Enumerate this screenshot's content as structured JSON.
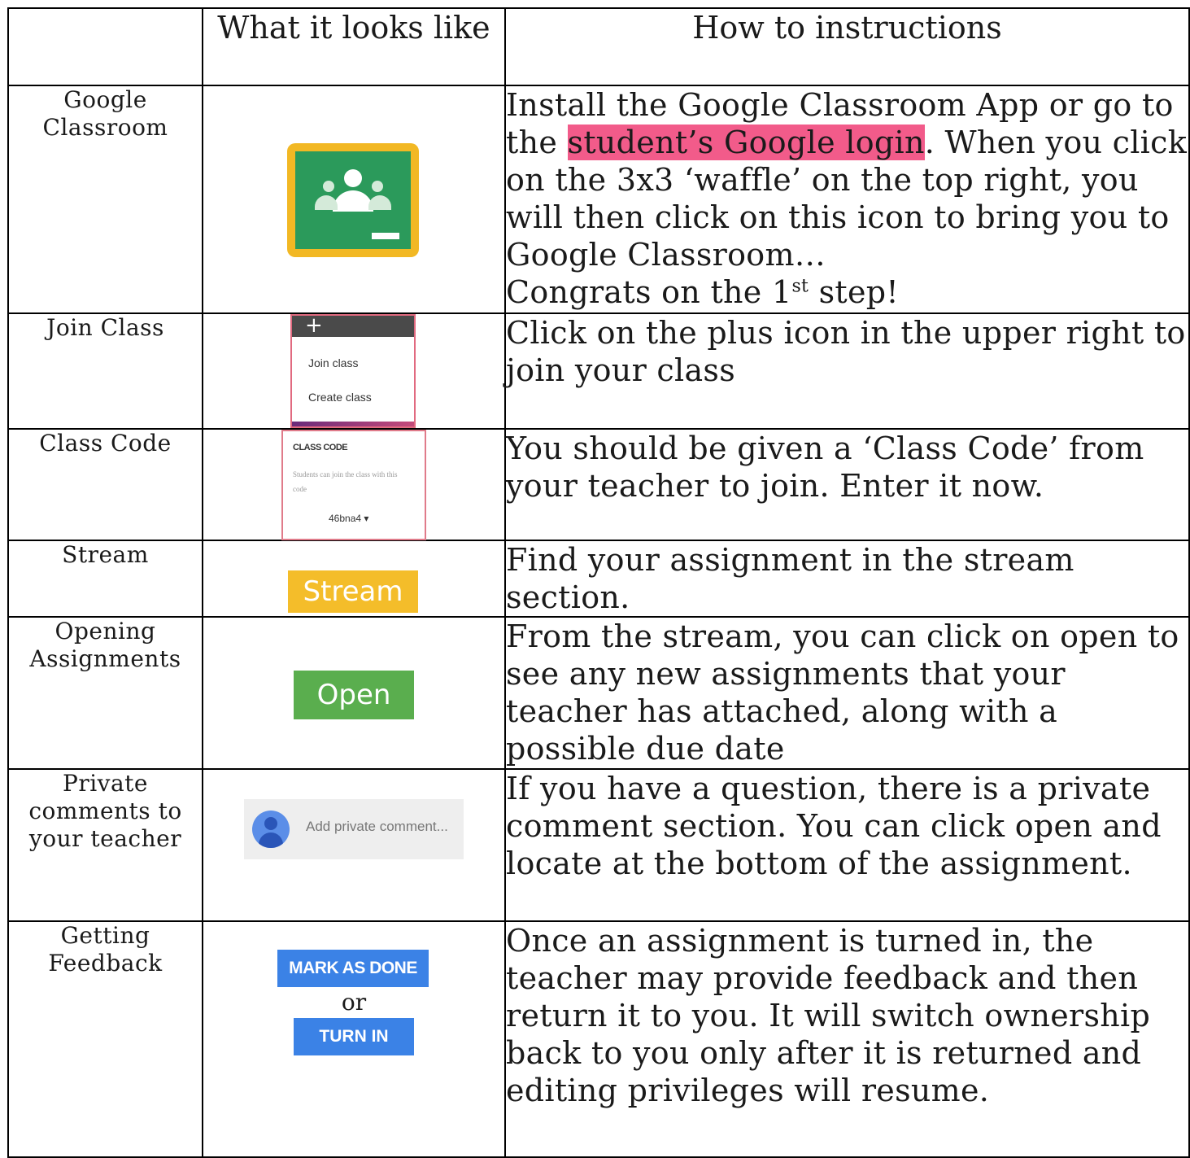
{
  "header": {
    "col1": "",
    "col2": "What it looks like",
    "col3": "How to instructions"
  },
  "rows": [
    {
      "label": "Google Classroom",
      "icon": "google-classroom-icon",
      "instr_before": "Install the Google Classroom App or go to the ",
      "instr_highlight": "student’s Google login",
      "instr_after": ". When you click on the 3x3 ‘waffle’ on the top right, you will then click on this icon to bring you to Google Classroom…",
      "instr_congrats": "Congrats on the 1",
      "instr_sup": "st",
      "instr_end": " step!",
      "highlight_color": "#f25b8a"
    },
    {
      "label": "Join Class",
      "menu_plus": "+",
      "menu_items": [
        "Join class",
        "Create class"
      ],
      "instr": "Click on the plus icon in the upper right to join your class"
    },
    {
      "label": "Class Code",
      "code_title": "CLASS CODE",
      "code_desc": "Students can join the class with this code",
      "code_value": "46bna4 ▾",
      "instr": "You should be given a ‘Class Code’ from your teacher to join. Enter it now."
    },
    {
      "label": "Stream",
      "button": "Stream",
      "button_color": "#f4bd2a",
      "instr": "Find your assignment in the stream section."
    },
    {
      "label": "Opening Assignments",
      "button": "Open",
      "button_color": "#5aae4e",
      "instr": "From the stream, you can click on open to see any new assignments that your teacher has attached, along with a possible due date"
    },
    {
      "label": "Private comments to your teacher",
      "placeholder": "Add private comment...",
      "icon": "avatar-icon",
      "instr": "If you have a question, there is a private comment section. You can click open and locate at the bottom of the assignment."
    },
    {
      "label": "Getting Feedback",
      "button1": "MARK AS DONE",
      "or": "or",
      "button2": "TURN IN",
      "button_color": "#3b82e6",
      "instr": "Once an assignment is turned in, the teacher may provide feedback and then return it to you. It will switch ownership back to you only after it is returned and editing privileges will resume."
    }
  ]
}
